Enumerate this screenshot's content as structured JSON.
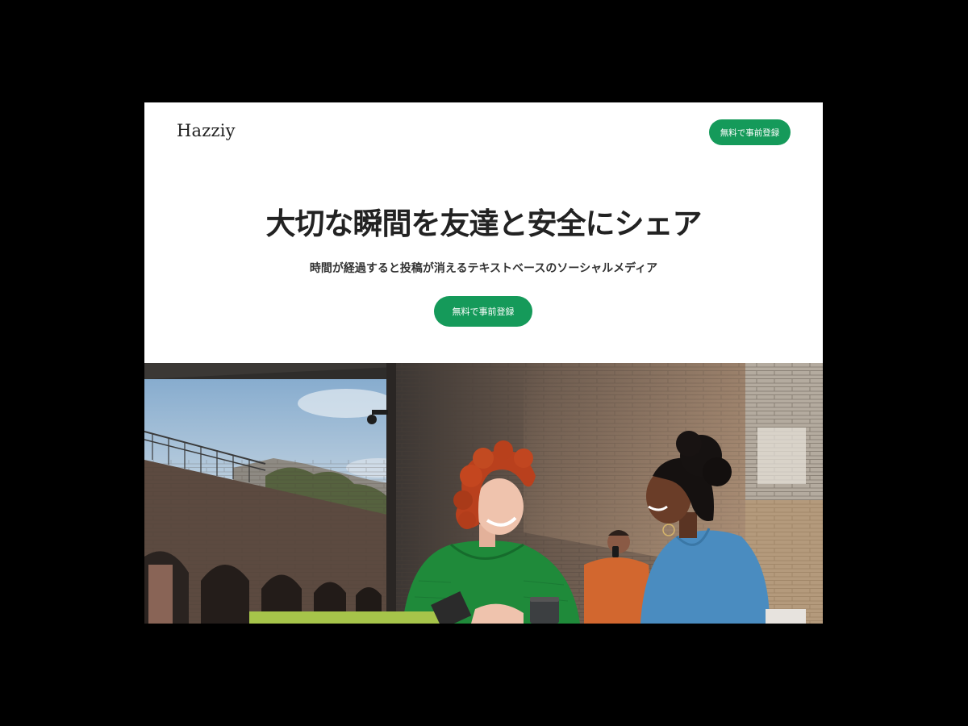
{
  "header": {
    "logo": "Hazziy",
    "cta_label": "無料で事前登録"
  },
  "hero": {
    "title": "大切な瞬間を友達と安全にシェア",
    "subtitle": "時間が経過すると投稿が消えるテキストベースのソーシャルメディア",
    "cta_label": "無料で事前登録"
  },
  "image": {
    "description_icon": "photo-friends-cafe"
  },
  "colors": {
    "accent": "#159a5a",
    "background": "#ffffff",
    "text": "#222222"
  }
}
